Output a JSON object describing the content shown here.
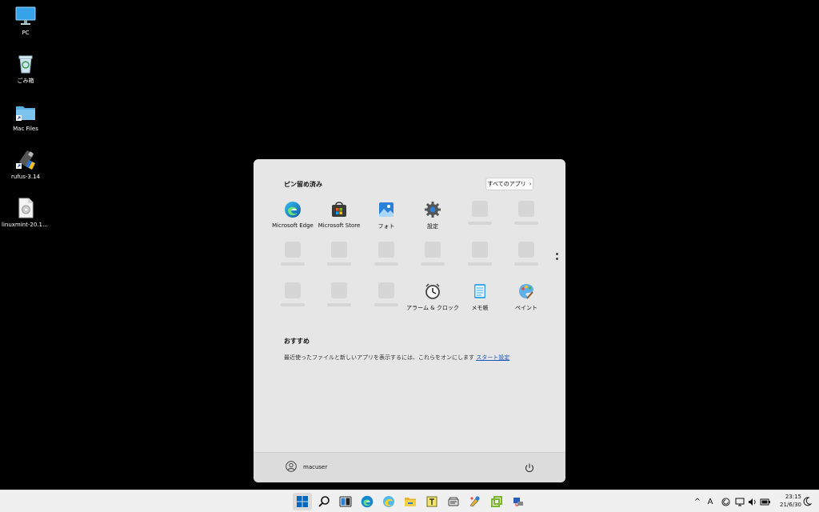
{
  "desktop": {
    "icons": [
      {
        "label": "PC",
        "icon": "monitor-icon"
      },
      {
        "label": "ごみ箱",
        "icon": "recycle-bin-icon"
      },
      {
        "label": "Mac Files",
        "icon": "folder-shortcut-icon"
      },
      {
        "label": "rufus-3.14",
        "icon": "usb-drive-icon"
      },
      {
        "label": "linuxmint-20.1-x...",
        "icon": "disc-image-icon"
      }
    ]
  },
  "start": {
    "pinned_title": "ピン留め済み",
    "all_apps_label": "すべてのアプリ",
    "all_apps_chevron": "›",
    "apps": [
      {
        "label": "Microsoft Edge",
        "icon": "edge-icon"
      },
      {
        "label": "Microsoft Store",
        "icon": "store-icon"
      },
      {
        "label": "フォト",
        "icon": "photos-icon"
      },
      {
        "label": "設定",
        "icon": "settings-gear-icon"
      },
      {
        "label": "アラーム & クロック",
        "icon": "alarm-clock-icon"
      },
      {
        "label": "メモ帳",
        "icon": "notepad-icon"
      },
      {
        "label": "ペイント",
        "icon": "paint-icon"
      }
    ],
    "recommended_title": "おすすめ",
    "recommended_text": "最近使ったファイルと新しいアプリを表示するには、これらをオンにします",
    "recommended_link": "スタート設定",
    "user_name": "macuser"
  },
  "taskbar": {
    "buttons": [
      "start-windows-icon",
      "search-icon",
      "task-view-icon",
      "edge-icon",
      "edge-beta-icon",
      "file-explorer-icon",
      "notepad-plus-icon",
      "scanner-icon",
      "paint-app-icon",
      "vmware-icon",
      "network-share-icon"
    ],
    "tray": {
      "chevron": "^",
      "ime": "A"
    },
    "clock_time": "23:15",
    "clock_date": "21/6/30"
  },
  "colors": {
    "accent": "#0067c0",
    "link": "#1a55b8",
    "start_bg": "#e6e6e6",
    "taskbar_bg": "#f0f0f0"
  }
}
